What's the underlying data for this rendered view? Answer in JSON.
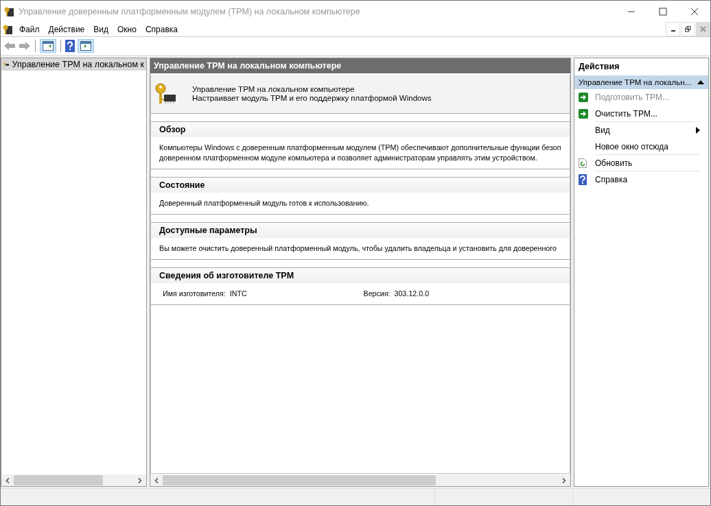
{
  "window": {
    "title": "Управление доверенным платформенным модулем (TPM) на локальном компьютере"
  },
  "menu": [
    "Файл",
    "Действие",
    "Вид",
    "Окно",
    "Справка"
  ],
  "tree": {
    "items": [
      {
        "label": "Управление TPM на локальном к",
        "selected": true
      }
    ]
  },
  "center": {
    "title": "Управление TPM на локальном компьютере",
    "intro": {
      "title": "Управление TPM на локальном компьютере",
      "subtitle": "Настраивает модуль TPM и его поддержку платформой Windows"
    },
    "sections": [
      {
        "kind": "text",
        "title": "Обзор",
        "lines": [
          "Компьютеры Windows с доверенным платформенным модулем (TPM) обеспечивают дополнительные функции безоп",
          "доверенном платформенном модуле компьютера и позволяет администраторам управлять этим устройством."
        ]
      },
      {
        "kind": "text",
        "title": "Состояние",
        "lines": [
          "Доверенный платформенный модуль готов к использованию."
        ]
      },
      {
        "kind": "text",
        "title": "Доступные параметры",
        "lines": [
          "Вы можете очистить доверенный платформенный модуль, чтобы удалить владельца и установить для доверенного"
        ]
      },
      {
        "kind": "fields",
        "title": "Сведения об изготовителе TPM",
        "fields": [
          {
            "label": "Имя изготовителя:",
            "value": "INTC"
          },
          {
            "label": "Версия:",
            "value": "303.12.0.0"
          }
        ]
      }
    ]
  },
  "actions": {
    "title": "Действия",
    "group": {
      "label": "Управление TPM на локальн...",
      "expanded": true
    },
    "items": [
      {
        "label": "Подготовить TPM...",
        "kind": "run",
        "disabled": true,
        "submenu": false,
        "divider": false
      },
      {
        "label": "Очистить TPM...",
        "kind": "run",
        "disabled": false,
        "submenu": false,
        "divider": true
      },
      {
        "label": "Вид",
        "kind": "plain",
        "disabled": false,
        "submenu": true,
        "divider": false
      },
      {
        "label": "Новое окно отсюда",
        "kind": "plain",
        "disabled": false,
        "submenu": false,
        "divider": true
      },
      {
        "label": "Обновить",
        "kind": "refresh",
        "disabled": false,
        "submenu": false,
        "divider": true
      },
      {
        "label": "Справка",
        "kind": "help",
        "disabled": false,
        "submenu": false,
        "divider": false
      }
    ]
  }
}
